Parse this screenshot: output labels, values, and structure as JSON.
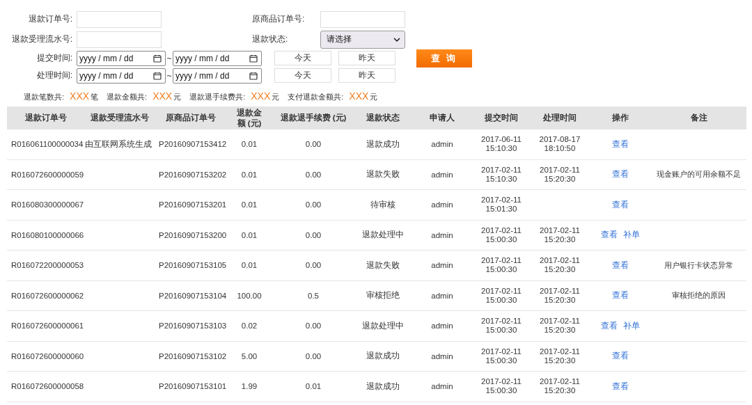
{
  "filters": {
    "refund_order_no": {
      "label": "退款订单号:"
    },
    "original_order_no": {
      "label": "原商品订单号:"
    },
    "refund_serial_no": {
      "label": "退款受理流水号:"
    },
    "refund_status": {
      "label": "退款状态:",
      "value": "请选择"
    },
    "date_rows": [
      {
        "label": "提交时间:",
        "from": "yyyy / mm / dd",
        "sep": "~",
        "to": "yyyy / mm / dd",
        "today": "今天",
        "yesterday": "昨天"
      },
      {
        "label": "处理时间:",
        "from": "yyyy / mm / dd",
        "sep": "~",
        "to": "yyyy / mm / dd",
        "today": "今天",
        "yesterday": "昨天"
      }
    ],
    "query_button": "查 询"
  },
  "summary": [
    {
      "label": "退款笔数共:",
      "value": "XXX",
      "unit": "笔"
    },
    {
      "label": "退款金额共:",
      "value": "XXX",
      "unit": "元"
    },
    {
      "label": "退款退手续费共:",
      "value": "XXX",
      "unit": "元"
    },
    {
      "label": "支付退款金额共:",
      "value": "XXX",
      "unit": "元"
    }
  ],
  "table": {
    "columns": [
      "退款订单号",
      "退款受理流水号",
      "原商品订单号",
      "退款金额 (元)",
      "退款退手续费 (元)",
      "退款状态",
      "申请人",
      "提交时间",
      "处理时间",
      "操作",
      "备注"
    ],
    "rows": [
      {
        "refund_no": "R016061100000034",
        "serial_no": "由互联网系统生成",
        "order_no": "P20160907153412",
        "amount": "0.01",
        "fee": "0.00",
        "status": "退款成功",
        "applicant": "admin",
        "submitted": [
          "2017-06-11",
          "15:10:30"
        ],
        "processed": [
          "2017-08-17",
          "18:10:50"
        ],
        "actions": [
          "查看"
        ]
      },
      {
        "refund_no": "R016072600000059",
        "order_no": "P20160907153202",
        "amount": "0.01",
        "fee": "0.00",
        "status": "退款失败",
        "applicant": "admin",
        "submitted": [
          "2017-02-11",
          "15:10:30"
        ],
        "processed": [
          "2017-02-11",
          "15:20:30"
        ],
        "actions": [
          "查看"
        ],
        "remark": "现金账户的可用余额不足"
      },
      {
        "refund_no": "R016080300000067",
        "order_no": "P20160907153201",
        "amount": "0.01",
        "fee": "0.00",
        "status": "待审核",
        "applicant": "admin",
        "submitted": [
          "2017-02-11",
          "15:01:30"
        ],
        "actions": [
          "查看"
        ]
      },
      {
        "refund_no": "R016080100000066",
        "order_no": "P20160907153200",
        "amount": "0.01",
        "fee": "0.00",
        "status": "退款处理中",
        "applicant": "admin",
        "submitted": [
          "2017-02-11",
          "15:00:30"
        ],
        "processed": [
          "2017-02-11",
          "15:20:30"
        ],
        "actions": [
          "查看",
          "补单"
        ]
      },
      {
        "refund_no": "R016072200000053",
        "order_no": "P20160907153105",
        "amount": "0.01",
        "fee": "0.00",
        "status": "退款失败",
        "applicant": "admin",
        "submitted": [
          "2017-02-11",
          "15:00:30"
        ],
        "processed": [
          "2017-02-11",
          "15:20:30"
        ],
        "actions": [
          "查看"
        ],
        "remark": "用户银行卡状态异常"
      },
      {
        "refund_no": "R016072600000062",
        "order_no": "P20160907153104",
        "amount": "100.00",
        "fee": "0.5",
        "status": "审核拒绝",
        "applicant": "admin",
        "submitted": [
          "2017-02-11",
          "15:00:30"
        ],
        "processed": [
          "2017-02-11",
          "15:20:30"
        ],
        "actions": [
          "查看"
        ],
        "remark": "审核拒绝的原因"
      },
      {
        "refund_no": "R016072600000061",
        "order_no": "P20160907153103",
        "amount": "0.02",
        "fee": "0.00",
        "status": "退款处理中",
        "applicant": "admin",
        "submitted": [
          "2017-02-11",
          "15:00:30"
        ],
        "processed": [
          "2017-02-11",
          "15:20:30"
        ],
        "actions": [
          "查看",
          "补单"
        ]
      },
      {
        "refund_no": "R016072600000060",
        "order_no": "P20160907153102",
        "amount": "5.00",
        "fee": "0.00",
        "status": "退款成功",
        "applicant": "admin",
        "submitted": [
          "2017-02-11",
          "15:00:30"
        ],
        "processed": [
          "2017-02-11",
          "15:20:30"
        ],
        "actions": [
          "查看"
        ]
      },
      {
        "refund_no": "R016072600000058",
        "order_no": "P20160907153101",
        "amount": "1.99",
        "fee": "0.01",
        "status": "退款成功",
        "applicant": "admin",
        "submitted": [
          "2017-02-11",
          "15:00:30"
        ],
        "processed": [
          "2017-02-11",
          "15:20:30"
        ],
        "actions": [
          "查看"
        ]
      }
    ]
  }
}
